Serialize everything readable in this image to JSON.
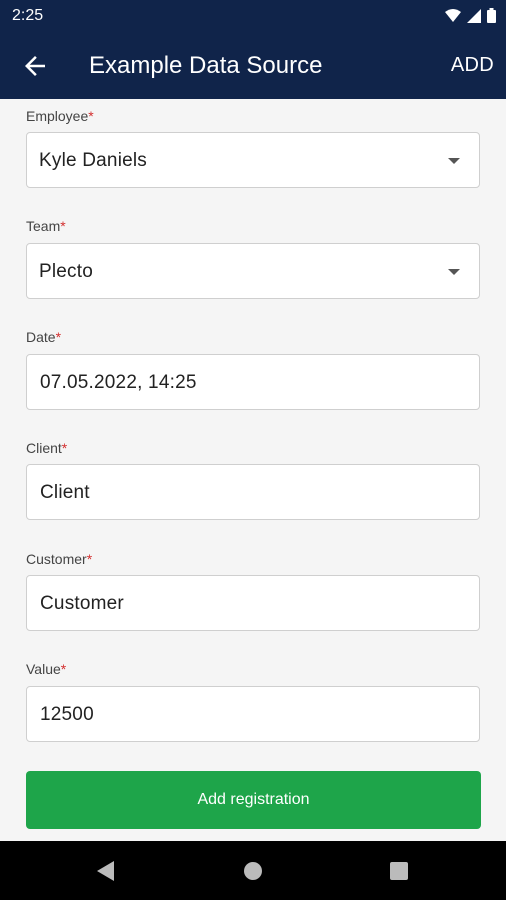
{
  "status_bar": {
    "time": "2:25",
    "icons": [
      "wifi-icon",
      "signal-icon",
      "battery-icon"
    ]
  },
  "app_bar": {
    "title": "Example Data Source",
    "add_label": "ADD",
    "back_icon": "arrow-left-icon"
  },
  "form": {
    "employee": {
      "label": "Employee",
      "required_mark": "*",
      "value": "Kyle Daniels"
    },
    "team": {
      "label": "Team",
      "required_mark": "*",
      "value": "Plecto"
    },
    "date": {
      "label": "Date",
      "required_mark": "*",
      "value": "07.05.2022, 14:25"
    },
    "client": {
      "label": "Client",
      "required_mark": "*",
      "value": "Client"
    },
    "customer": {
      "label": "Customer",
      "required_mark": "*",
      "value": "Customer"
    },
    "value": {
      "label": "Value",
      "required_mark": "*",
      "value": "12500"
    }
  },
  "submit": {
    "label": "Add registration"
  },
  "colors": {
    "app_bar_bg": "#10244a",
    "button_green": "#1ea54a",
    "required_red": "#d32f2f"
  },
  "nav_bar": {
    "icons": [
      "back-triangle-icon",
      "home-circle-icon",
      "recents-square-icon"
    ]
  }
}
